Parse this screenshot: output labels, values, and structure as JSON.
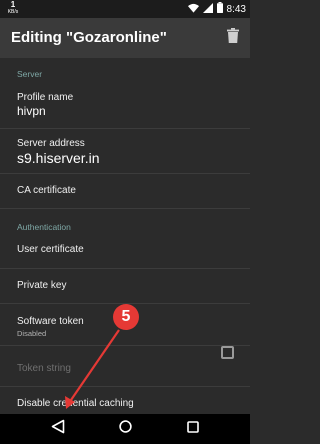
{
  "status_bar": {
    "net_speed": "1",
    "net_unit": "KB/s",
    "time": "8:43",
    "icons": [
      "wifi-icon",
      "signal-icon",
      "battery-icon"
    ]
  },
  "app_bar": {
    "title": "Editing \"Gozaronline\"",
    "delete_icon": "trash-icon"
  },
  "sections": {
    "server": "Server",
    "authentication": "Authentication"
  },
  "prefs": {
    "profile_name": {
      "label": "Profile name",
      "value": "hivpn"
    },
    "server_address": {
      "label": "Server address",
      "value": "s9.hiserver.in"
    },
    "ca_certificate": {
      "label": "CA certificate"
    },
    "user_certificate": {
      "label": "User certificate"
    },
    "private_key": {
      "label": "Private key"
    },
    "software_token": {
      "label": "Software token",
      "summary": "Disabled"
    },
    "token_string": {
      "label": "Token string"
    },
    "disable_credential_caching": {
      "label": "Disable credential caching",
      "checked": false
    }
  },
  "annotation": {
    "step": "5",
    "color": "#e53935"
  },
  "nav_bar": {
    "icons": [
      "back-icon",
      "home-icon",
      "recents-icon"
    ]
  },
  "colors": {
    "background": "#2b2b2b",
    "app_bar": "#3a3a3a",
    "accent": "#7fa8a6"
  }
}
